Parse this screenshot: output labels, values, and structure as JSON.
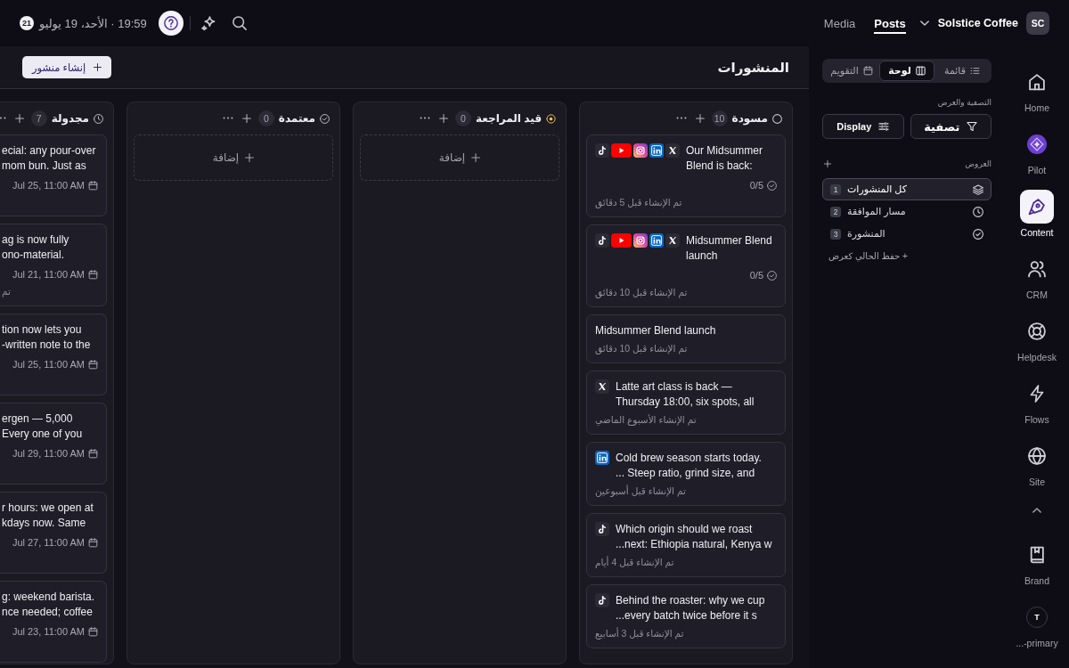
{
  "topbar": {
    "notification_count": "21",
    "datetime": "19:59 · الأحد، 19 يوليو",
    "tabs": [
      {
        "label": "Posts",
        "selected": true
      },
      {
        "label": "Media",
        "selected": false
      }
    ],
    "workspace": "Solstice Coffee",
    "avatar": "SC"
  },
  "page": {
    "title": "المنشورات",
    "create_button": "إنشاء منشور"
  },
  "board": {
    "columns": [
      {
        "kind": "draft",
        "name": "مسودة",
        "count": "10",
        "cards": [
          {
            "channels": [
              {
                "kind": "tiktok"
              },
              {
                "kind": "youtube"
              },
              {
                "kind": "instagram"
              },
              {
                "kind": "linkedin"
              },
              {
                "kind": "x"
              }
            ],
            "title": "Our Midsummer\nBlend is back:",
            "meta": {
              "kind": "progress",
              "text": "0/5"
            },
            "created": "تم الإنشاء قبل 5 دقائق"
          },
          {
            "channels": [
              {
                "kind": "tiktok"
              },
              {
                "kind": "youtube"
              },
              {
                "kind": "instagram"
              },
              {
                "kind": "linkedin"
              },
              {
                "kind": "x"
              }
            ],
            "title": "Midsummer Blend\nlaunch",
            "meta": {
              "kind": "progress",
              "text": "0/5"
            },
            "created": "تم الإنشاء قبل 10 دقائق"
          },
          {
            "title": "Midsummer Blend launch",
            "created": "تم الإنشاء قبل 10 دقائق"
          },
          {
            "channels": [
              {
                "kind": "x"
              }
            ],
            "title": "Latte art class is back —\nThursday 18:00, six spots, all",
            "created": "تم الإنشاء الأسبوع الماضي"
          },
          {
            "channels": [
              {
                "kind": "linkedin"
              }
            ],
            "title": "Cold brew season starts today.\n... Steep ratio, grind size, and",
            "created": "تم الإنشاء قبل أسبوعين"
          },
          {
            "channels": [
              {
                "kind": "tiktok"
              }
            ],
            "title": "Which origin should we roast\n...next: Ethiopia natural, Kenya w",
            "created": "تم الإنشاء قبل 4 أيام"
          },
          {
            "channels": [
              {
                "kind": "tiktok"
              }
            ],
            "title": "Behind the roaster: why we cup\n...every batch twice before it s",
            "created": "تم الإنشاء قبل 3 أسابيع"
          }
        ]
      },
      {
        "kind": "review",
        "name": "قيد المراجعة",
        "count": "0",
        "add_label": "إضافة"
      },
      {
        "kind": "approved",
        "name": "معتمدة",
        "count": "0",
        "add_label": "إضافة"
      },
      {
        "kind": "scheduled",
        "name": "مجدولة",
        "count": "7",
        "cards": [
          {
            "title": "ecial: any pour-over\nmom bun. Just as",
            "meta": {
              "kind": "schedule",
              "text": "Jul 25, 11:00 AM"
            }
          },
          {
            "title": "ag is now fully\nono-material.",
            "meta": {
              "kind": "schedule",
              "text": "Jul 21, 11:00 AM"
            },
            "created": "تم"
          },
          {
            "title": "tion now lets you\n-written note to the",
            "meta": {
              "kind": "schedule",
              "text": "Jul 25, 11:00 AM"
            }
          },
          {
            "title": "ergen — 5,000\nEvery one of you",
            "meta": {
              "kind": "schedule",
              "text": "Jul 29, 11:00 AM"
            }
          },
          {
            "title": "r hours: we open at\nkdays now. Same",
            "meta": {
              "kind": "schedule",
              "text": "Jul 27, 11:00 AM"
            }
          },
          {
            "title": "g: weekend barista.\nnce needed; coffee",
            "meta": {
              "kind": "schedule",
              "text": "Jul 23, 11:00 AM"
            }
          }
        ]
      }
    ]
  },
  "panel": {
    "view_switcher": [
      {
        "kind": "list",
        "label": "قائمة",
        "selected": false
      },
      {
        "kind": "board",
        "label": "لوحة",
        "selected": true
      },
      {
        "kind": "calendar",
        "label": "التقويم",
        "selected": false
      }
    ],
    "filters": {
      "heading": "التصفية والعرض",
      "filter_button": "تصفية",
      "display_button": "Display"
    },
    "views": {
      "heading": "العروض",
      "items": [
        {
          "kind": "layers",
          "label": "كل المنشورات",
          "count": "1",
          "selected": true
        },
        {
          "kind": "clock",
          "label": "مسار الموافقة",
          "count": "2",
          "selected": false
        },
        {
          "kind": "check",
          "label": "المنشورة",
          "count": "3",
          "selected": false
        }
      ],
      "save_link": "+ حفظ الحالي كعرض"
    }
  },
  "nav_rail": {
    "items": [
      {
        "kind": "home",
        "label": "Home",
        "selected": false
      },
      {
        "kind": "pilot",
        "label": "Pilot",
        "selected": false
      },
      {
        "kind": "content",
        "label": "Content",
        "selected": true
      },
      {
        "kind": "crm",
        "label": "CRM",
        "selected": false
      },
      {
        "kind": "helpdesk",
        "label": "Helpdesk",
        "selected": false
      },
      {
        "kind": "flows",
        "label": "Flows",
        "selected": false
      },
      {
        "kind": "site",
        "label": "Site",
        "selected": false
      }
    ],
    "bottom_items": [
      {
        "kind": "brand",
        "label": "Brand",
        "selected": false
      }
    ],
    "workspace": {
      "initial": "T",
      "label": "...-primary"
    }
  }
}
